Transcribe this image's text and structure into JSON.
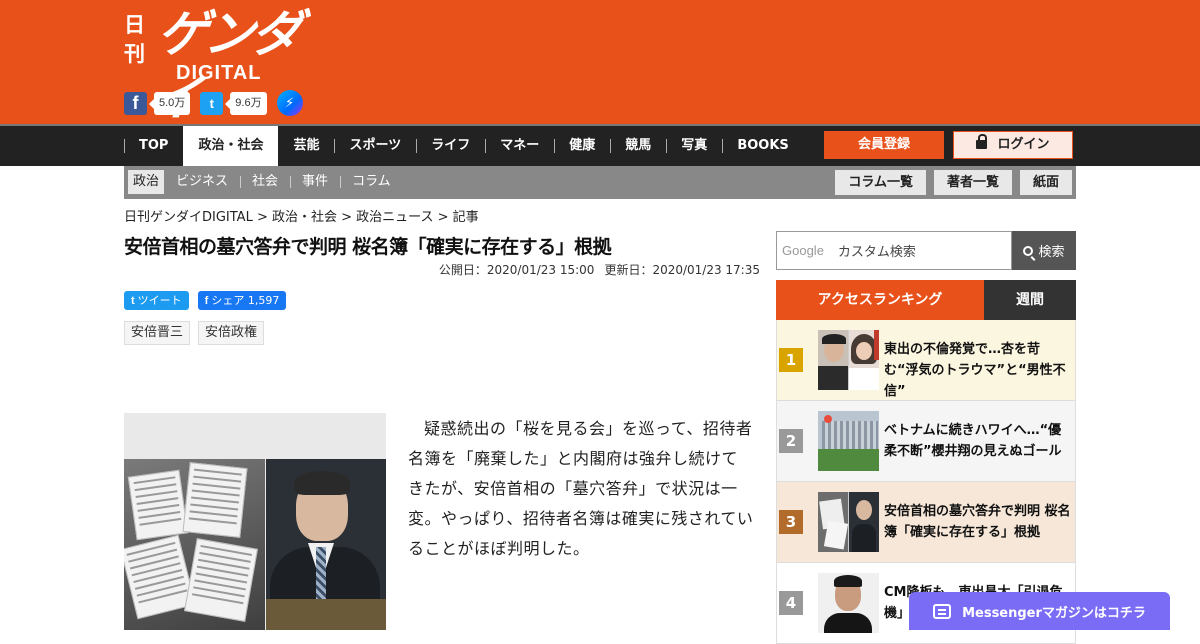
{
  "site": {
    "logo_nikkan": "日刊",
    "logo_main": "ゲンダイ",
    "logo_sub": "DIGITAL",
    "facebook_count": "5.0万",
    "twitter_count": "9.6万"
  },
  "nav": {
    "items": [
      "TOP",
      "政治・社会",
      "芸能",
      "スポーツ",
      "ライフ",
      "マネー",
      "健康",
      "競馬",
      "写真",
      "BOOKS"
    ],
    "active": "政治・社会",
    "register_label": "会員登録",
    "login_label": "ログイン"
  },
  "subnav": {
    "items": [
      "政治",
      "ビジネス",
      "社会",
      "事件",
      "コラム"
    ],
    "buttons": [
      "コラム一覧",
      "著者一覧",
      "紙面"
    ]
  },
  "breadcrumb": "日刊ゲンダイDIGITAL > 政治・社会 > 政治ニュース > 記事",
  "article": {
    "title": "安倍首相の墓穴答弁で判明 桜名簿「確実に存在する」根拠",
    "published": "公開日：2020/01/23 15:00",
    "updated": "更新日：2020/01/23 17:35",
    "tweet_label": "ツイート",
    "share_label": "シェア 1,597",
    "tags": [
      "安倍晋三",
      "安倍政権"
    ],
    "body": "疑惑続出の「桜を見る会」を巡って、招待者名簿を「廃棄した」と内閣府は強弁し続けてきたが、安倍首相の「墓穴答弁」で状況は一変。やっぱり、招待者名簿は確実に残されていることがほぼ判明した。"
  },
  "search": {
    "google_label": "Google",
    "placeholder": "カスタム検索",
    "button_label": "検索"
  },
  "ranking": {
    "tab_access": "アクセスランキング",
    "tab_weekly": "週間",
    "items": [
      {
        "rank": "1",
        "title": "東出の不倫発覚で…杏を苛む“浮気のトラウマ”と“男性不信”",
        "color": "#d9a400",
        "bg": "#fbf6e0"
      },
      {
        "rank": "2",
        "title": "ベトナムに続きハワイへ…“優柔不断”櫻井翔の見えぬゴール",
        "color": "#999999",
        "bg": "#f5f5f5"
      },
      {
        "rank": "3",
        "title": "安倍首相の墓穴答弁で判明 桜名簿「確実に存在する」根拠",
        "color": "#b36b2c",
        "bg": "#f6e7d8"
      },
      {
        "rank": "4",
        "title": "CM降板も…東出昌大「引退危機」",
        "color": "#999999",
        "bg": "#ffffff"
      }
    ]
  },
  "messenger_banner": "Messengerマガジンはコチラ"
}
